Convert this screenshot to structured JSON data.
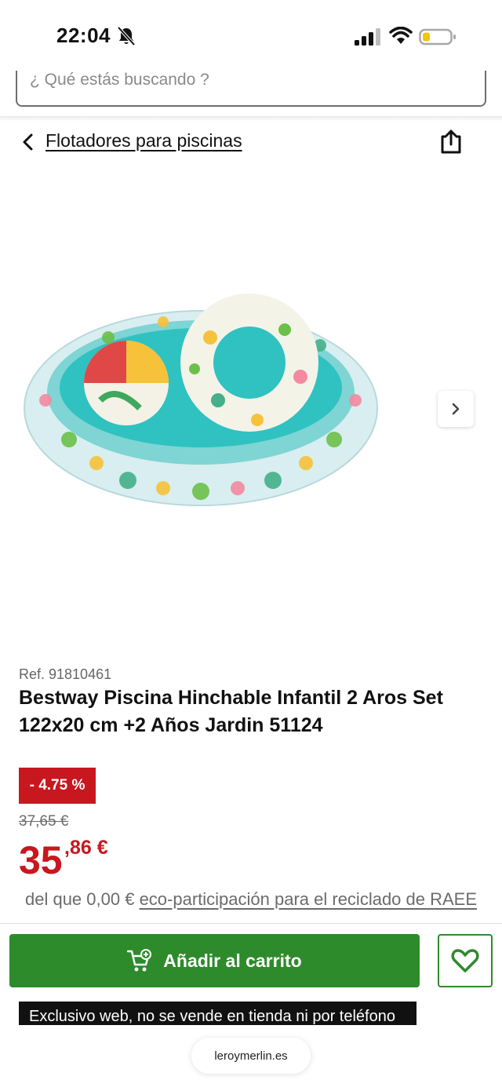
{
  "status_bar": {
    "time": "22:04"
  },
  "search": {
    "placeholder": "¿ Qué estás buscando ?"
  },
  "breadcrumb": {
    "label": "Flotadores para piscinas"
  },
  "product": {
    "ref": "Ref. 91810461",
    "title": "Bestway Piscina Hinchable Infantil 2 Aros Set 122x20 cm +2 Años Jardin 51124",
    "discount": "- 4.75 %",
    "old_price": "37,65 €",
    "price_int": "35",
    "price_dec": ",86 €",
    "eco_prefix": "del que 0,00 € ",
    "eco_link": "eco-participación para el reciclado de RAEE"
  },
  "actions": {
    "add_to_cart": "Añadir al carrito",
    "exclusive": "Exclusivo web, no se vende en tienda ni por teléfono"
  },
  "browser": {
    "url": "leroymerlin.es"
  },
  "icons": [
    "bell-slash-icon",
    "signal-icon",
    "wifi-icon",
    "battery-icon",
    "back-chevron-icon",
    "share-icon",
    "chevron-right-icon",
    "cart-add-icon",
    "heart-icon"
  ],
  "colors": {
    "brand_green": "#2e8b2b",
    "price_red": "#c8171e"
  }
}
